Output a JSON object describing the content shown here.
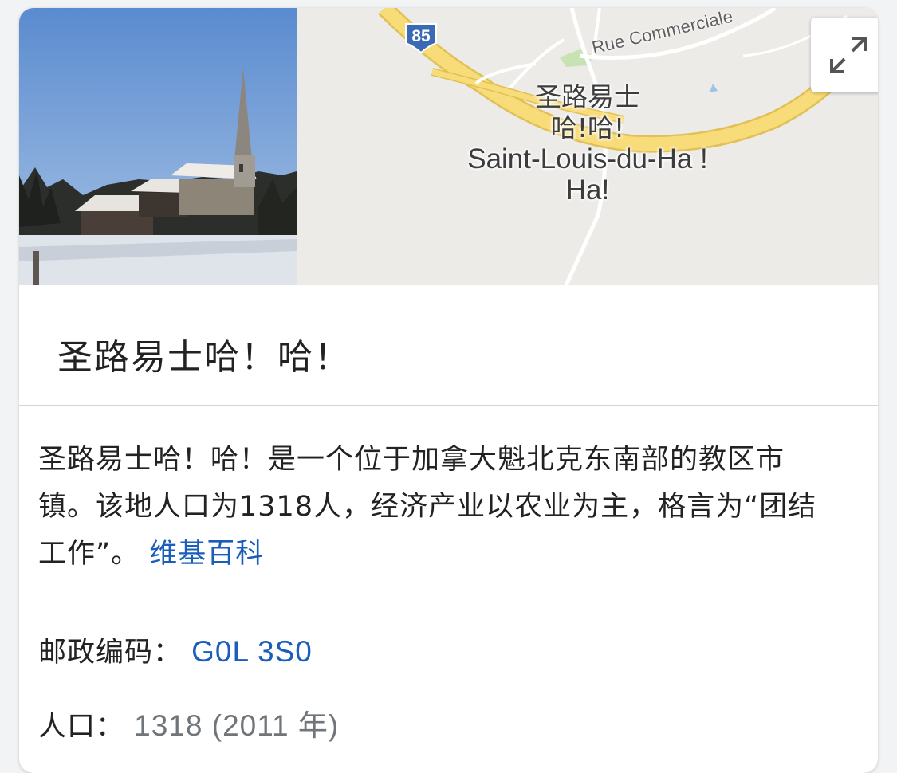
{
  "map": {
    "place_label_zh": "圣路易士哈!哈!",
    "place_label_fr": "Saint-Louis-du-Ha ! Ha!",
    "road_label": "Rue Commerciale",
    "route_number": "85"
  },
  "title": "圣路易士哈！哈！",
  "description": {
    "text": "圣路易士哈！哈！是一个位于加拿大魁北克东南部的教区市镇。该地人口为1318人，经济产业以农业为主，格言为“团结工作”。",
    "source_link": "维基百科"
  },
  "facts": {
    "postal_label": "邮政编码：",
    "postal_value": "G0L 3S0",
    "population_label": "人口：",
    "population_value": "1318 (2011 年)"
  },
  "colors": {
    "link": "#1a5dbb",
    "highway": "#f4d66b",
    "map_bg": "#ecebe8"
  },
  "icons": [
    "expand-icon",
    "route-shield-icon"
  ]
}
